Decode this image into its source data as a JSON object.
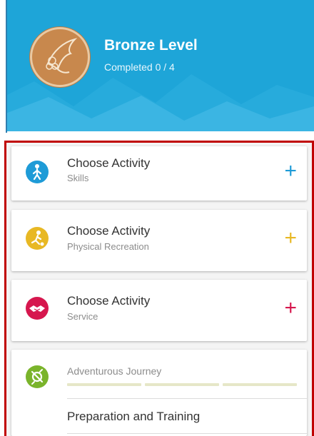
{
  "header": {
    "level_title": "Bronze Level",
    "progress_text": "Completed 0 / 4",
    "background_color": "#1ea5d8",
    "badge_color": "#c8884d"
  },
  "activities": [
    {
      "title": "Choose Activity",
      "subtitle": "Skills",
      "icon": "running-person-icon",
      "color": "#1e9bd7",
      "action_icon": "plus-icon",
      "action_glyph": "+"
    },
    {
      "title": "Choose Activity",
      "subtitle": "Physical Recreation",
      "icon": "ball-kick-icon",
      "color": "#e8b824",
      "action_icon": "plus-icon",
      "action_glyph": "+"
    },
    {
      "title": "Choose Activity",
      "subtitle": "Service",
      "icon": "handshake-icon",
      "color": "#d6174e",
      "action_icon": "plus-icon",
      "action_glyph": "+"
    }
  ],
  "journey": {
    "title": "Adventurous Journey",
    "icon": "compass-icon",
    "color": "#7ab42b",
    "progress_segments": 3,
    "item_label": "Preparation and Training"
  }
}
